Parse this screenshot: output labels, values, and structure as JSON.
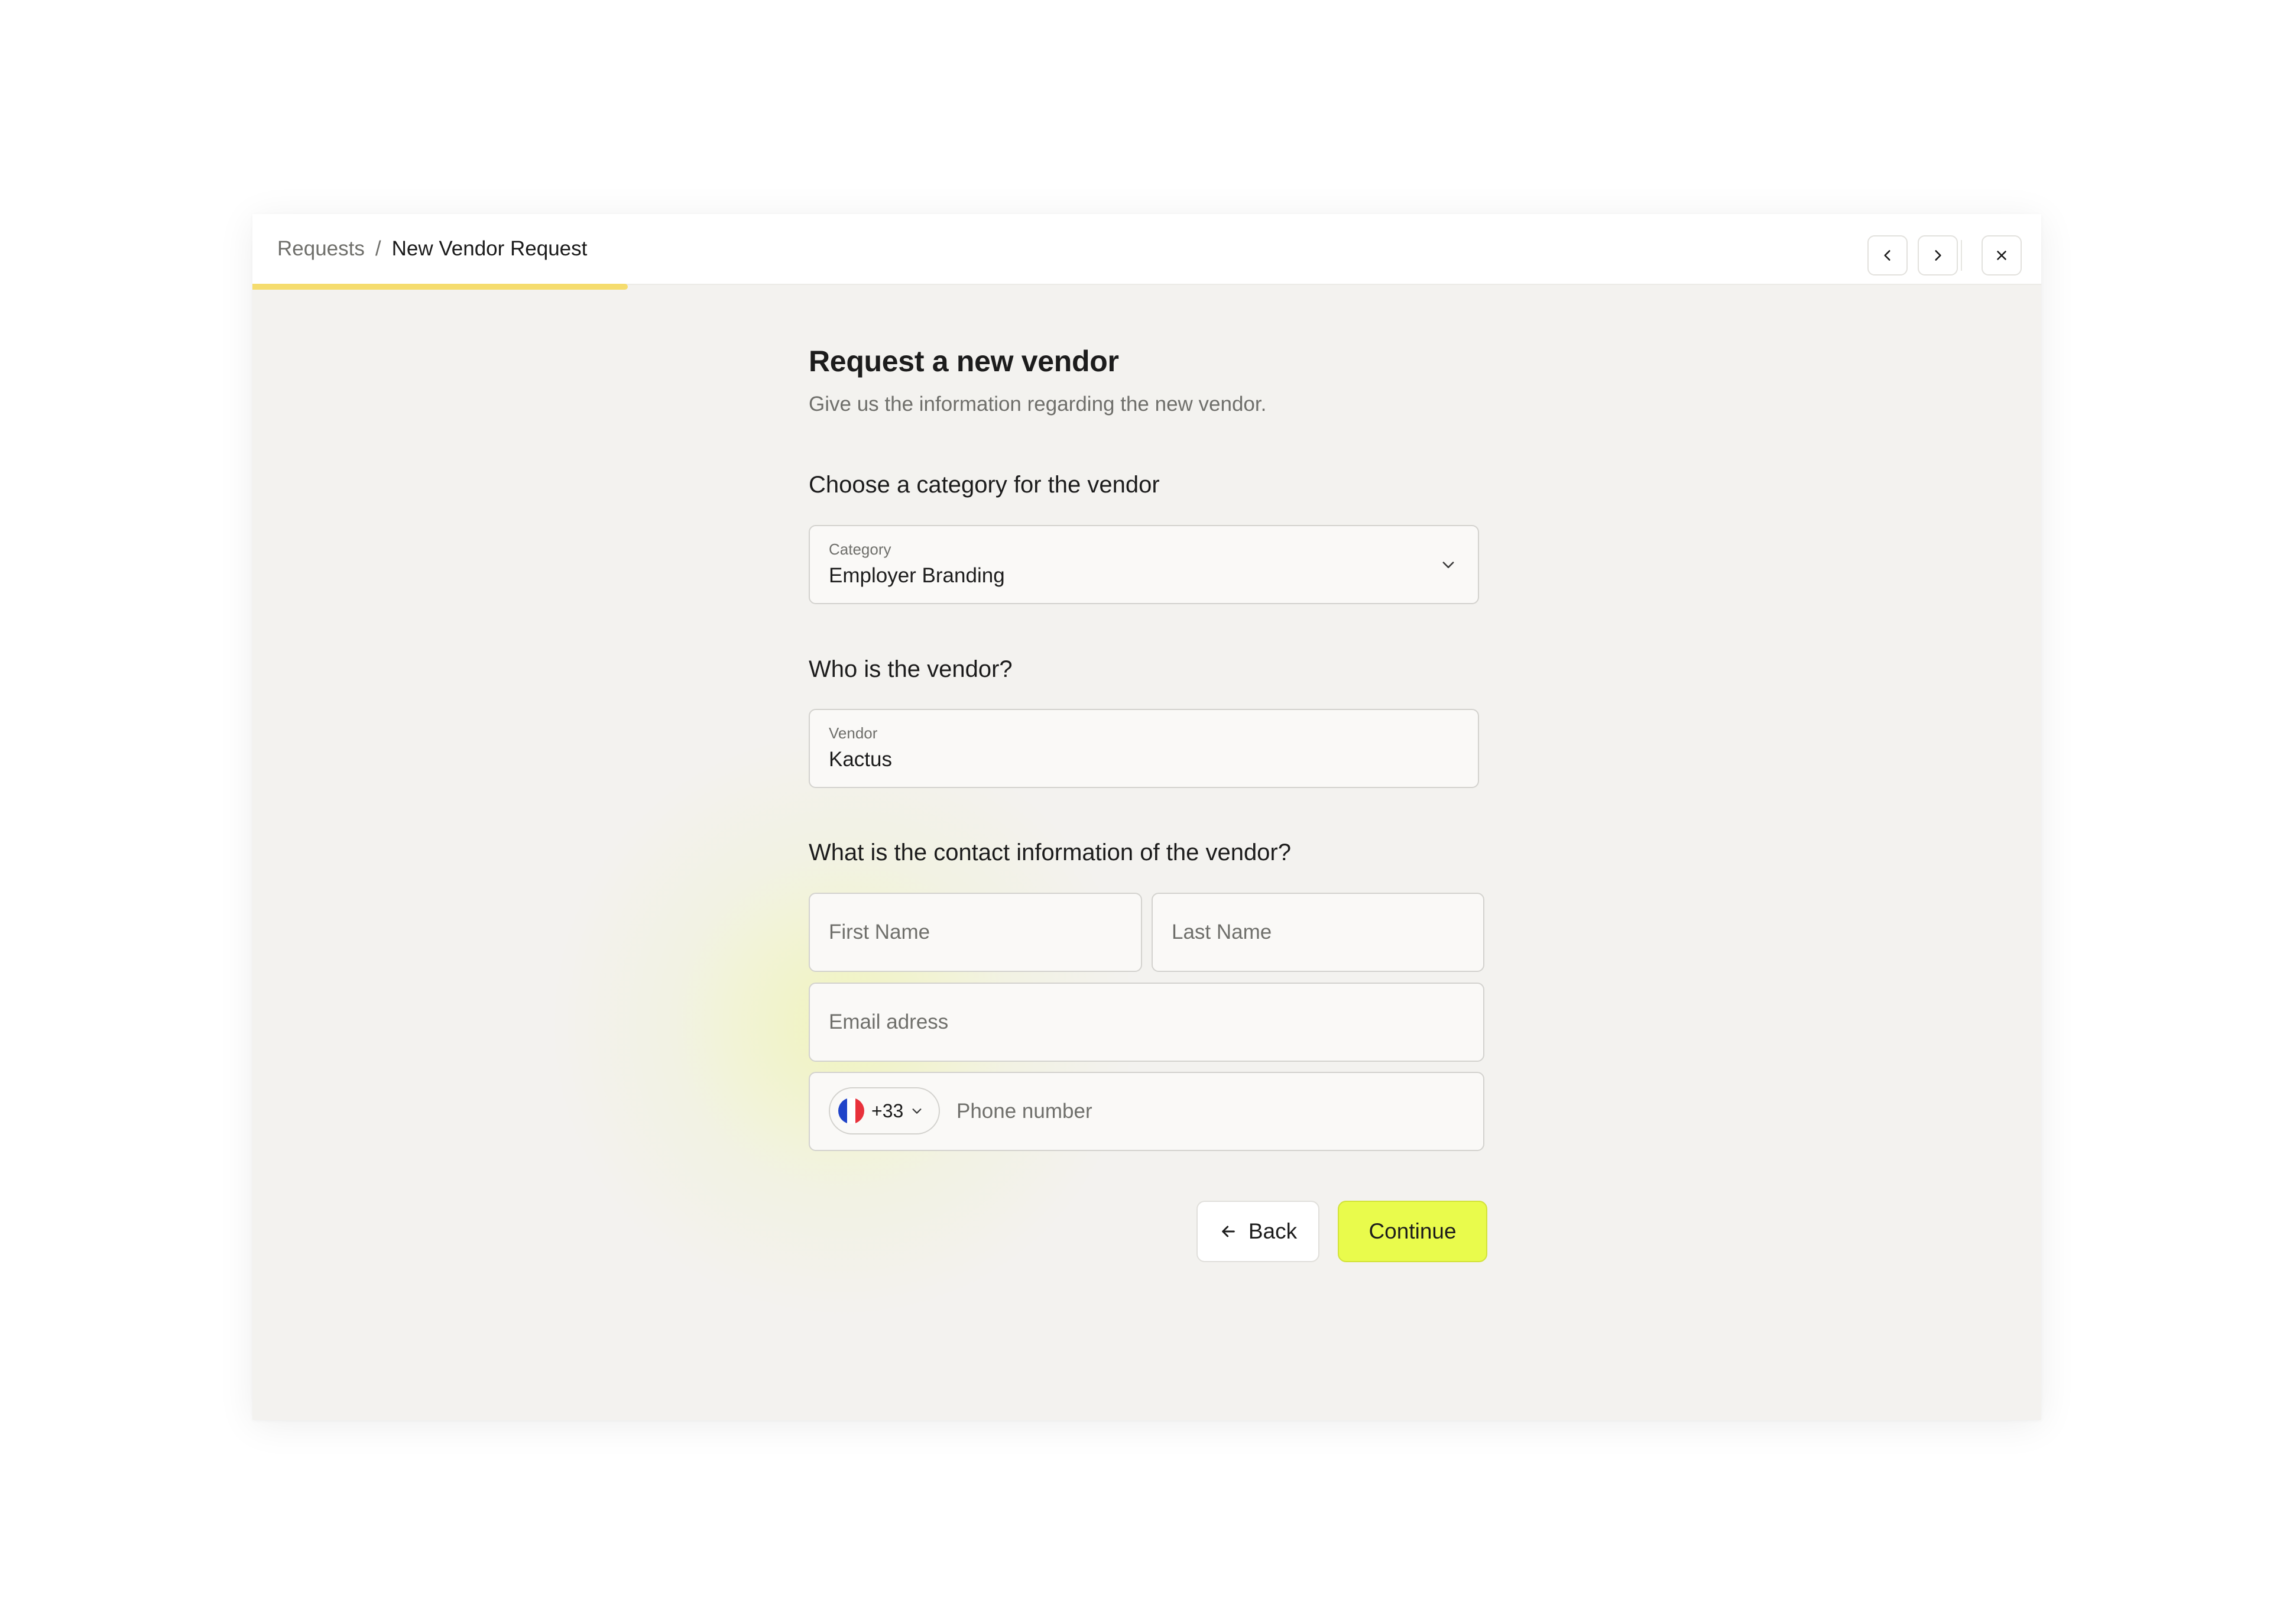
{
  "breadcrumb": {
    "root": "Requests",
    "separator": "/",
    "current": "New Vendor Request"
  },
  "progress": {
    "fraction": 0.21
  },
  "header": {
    "title": "Request a new vendor",
    "subtitle": "Give us the information regarding the new vendor."
  },
  "category_section": {
    "question": "Choose a category for the vendor",
    "label": "Category",
    "value": "Employer Branding"
  },
  "vendor_section": {
    "question": "Who is the vendor?",
    "label": "Vendor",
    "value": "Kactus"
  },
  "contact_section": {
    "question": "What is the contact information of the vendor?",
    "first_name_placeholder": "First Name",
    "last_name_placeholder": "Last Name",
    "email_placeholder": "Email adress",
    "country_code": "+33",
    "phone_placeholder": "Phone number"
  },
  "actions": {
    "back_label": "Back",
    "continue_label": "Continue"
  },
  "colors": {
    "accent": "#e9fb4c",
    "progress": "#f5dc6e",
    "background": "#f3f2ef"
  },
  "icons": [
    "chevron-left-icon",
    "chevron-right-icon",
    "close-icon",
    "chevron-down-icon",
    "arrow-left-icon",
    "france-flag-icon"
  ]
}
